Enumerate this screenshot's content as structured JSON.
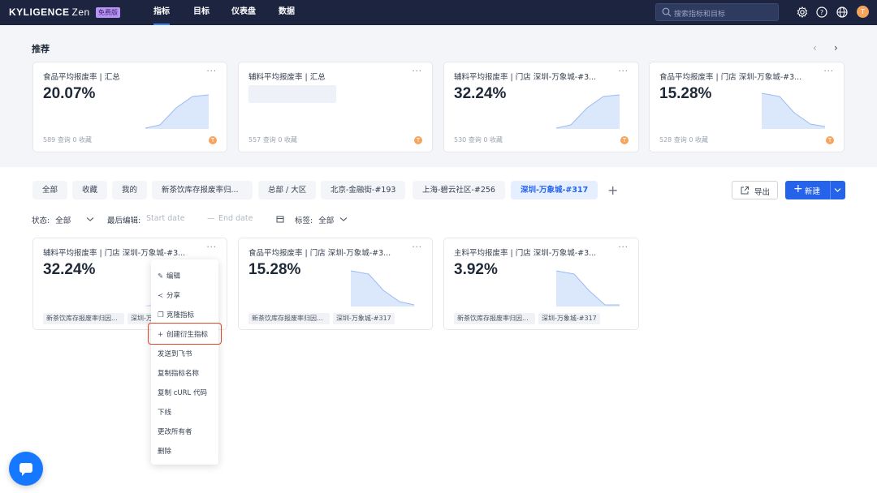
{
  "app": {
    "brand": "KYLIGENCE",
    "brand_suffix": "Zen",
    "plan_badge": "免费版"
  },
  "nav": [
    {
      "label": "指标",
      "active": true
    },
    {
      "label": "目标"
    },
    {
      "label": "仪表盘"
    },
    {
      "label": "数据"
    }
  ],
  "search": {
    "placeholder": "搜索指标和目标"
  },
  "user": {
    "avatar_letter": "T"
  },
  "recommend": {
    "title": "推荐",
    "cards": [
      {
        "title": "食品平均报废率 | 汇总",
        "value": "20.07%",
        "meta": "589 查询 0 收藏",
        "trend": "up"
      },
      {
        "title": "辅料平均报废率 | 汇总",
        "value": "",
        "meta": "557 查询 0 收藏",
        "trend": "none"
      },
      {
        "title": "辅料平均报废率 | 门店 深圳-万象城-#3...",
        "value": "32.24%",
        "meta": "530 查询 0 收藏",
        "trend": "up"
      },
      {
        "title": "食品平均报废率 | 门店 深圳-万象城-#3...",
        "value": "15.28%",
        "meta": "528 查询 0 收藏",
        "trend": "down"
      }
    ]
  },
  "tabs": [
    {
      "label": "全部"
    },
    {
      "label": "收藏"
    },
    {
      "label": "我的"
    },
    {
      "label": "新茶饮库存报废率归..."
    },
    {
      "label": "总部 / 大区"
    },
    {
      "label": "北京-金融街-#193"
    },
    {
      "label": "上海-碧云社区-#256"
    },
    {
      "label": "深圳-万象城-#317",
      "active": true
    }
  ],
  "actions": {
    "export": "导出",
    "new": "新建"
  },
  "filters": {
    "status_label": "状态:",
    "status_value": "全部",
    "last_edit_label": "最后编辑:",
    "start_placeholder": "Start date",
    "end_placeholder": "End date",
    "tags_label": "标签:",
    "tags_value": "全部"
  },
  "metric_cards": [
    {
      "title": "辅料平均报废率 | 门店 深圳-万象城-#3...",
      "value": "32.24%",
      "tags": [
        "新茶饮库存报废率归因...",
        "深圳-万..."
      ],
      "trend": "up"
    },
    {
      "title": "食品平均报废率 | 门店 深圳-万象城-#3...",
      "value": "15.28%",
      "tags": [
        "新茶饮库存报废率归因...",
        "深圳-万象城-#317"
      ],
      "trend": "down"
    },
    {
      "title": "主料平均报废率 | 门店 深圳-万象城-#3...",
      "value": "3.92%",
      "tags": [
        "新茶饮库存报废率归因...",
        "深圳-万象城-#317"
      ],
      "trend": "down"
    }
  ],
  "context_menu": [
    {
      "label": "编辑",
      "icon": "edit-icon"
    },
    {
      "label": "分享",
      "icon": "share-icon"
    },
    {
      "label": "克隆指标",
      "icon": "clone-icon"
    },
    {
      "label": "创建衍生指标",
      "icon": "plus-icon",
      "highlighted": true
    },
    {
      "label": "发送到飞书"
    },
    {
      "label": "复制指标名称"
    },
    {
      "label": "复制 cURL 代码"
    },
    {
      "label": "下线"
    },
    {
      "label": "更改所有者"
    },
    {
      "label": "删除"
    }
  ],
  "colors": {
    "nav_bg": "#1c2440",
    "accent": "#2563eb",
    "highlight": "#e0442b",
    "avatar": "#f6a35c"
  }
}
